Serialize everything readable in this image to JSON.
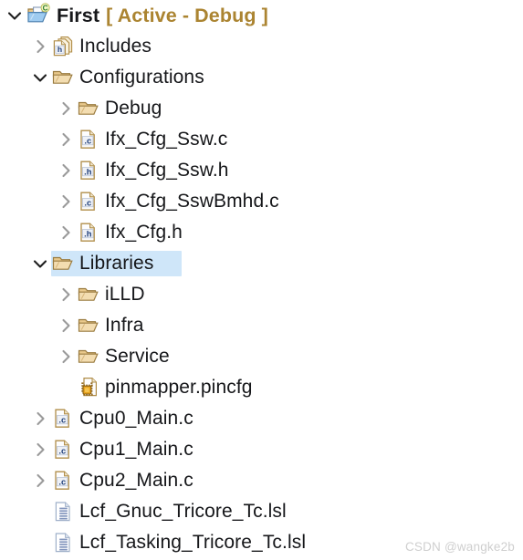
{
  "colors": {
    "background": "#ffffff",
    "text": "#16171a",
    "active_config_text": "#ab8431",
    "selection": "#cfe6f9",
    "folder_fill": "#e9c98c",
    "folder_stroke": "#9a7b3f",
    "file_stroke": "#b08d48",
    "c_badge_text": "#1f3f7a",
    "h_badge_text": "#1f3f7a",
    "lsl_line": "#8396bd",
    "chip_fill": "#e8a41f",
    "watermark": "#cfcfcf",
    "twisty_collapsed": "#9a9a9a",
    "twisty_expanded": "#1d1d1d"
  },
  "watermark": "CSDN @wangke2b",
  "tree": {
    "name": "project-explorer-tree",
    "items": [
      {
        "label": "First",
        "suffix": "[ Active - Debug ]",
        "level": 0,
        "icon": "project-folder-c-icon",
        "state": "expanded",
        "selected": false,
        "bold": true
      },
      {
        "label": "Includes",
        "level": 1,
        "icon": "includes-stack-h-icon",
        "state": "collapsed",
        "selected": false
      },
      {
        "label": "Configurations",
        "level": 1,
        "icon": "folder-icon",
        "state": "expanded",
        "selected": false
      },
      {
        "label": "Debug",
        "level": 2,
        "icon": "folder-icon",
        "state": "collapsed",
        "selected": false
      },
      {
        "label": "Ifx_Cfg_Ssw.c",
        "level": 2,
        "icon": "c-source-file-icon",
        "state": "collapsed",
        "selected": false
      },
      {
        "label": "Ifx_Cfg_Ssw.h",
        "level": 2,
        "icon": "h-header-file-icon",
        "state": "collapsed",
        "selected": false
      },
      {
        "label": "Ifx_Cfg_SswBmhd.c",
        "level": 2,
        "icon": "c-source-file-icon",
        "state": "collapsed",
        "selected": false
      },
      {
        "label": "Ifx_Cfg.h",
        "level": 2,
        "icon": "h-header-file-icon",
        "state": "collapsed",
        "selected": false
      },
      {
        "label": "Libraries",
        "level": 1,
        "icon": "folder-icon",
        "state": "expanded",
        "selected": true
      },
      {
        "label": "iLLD",
        "level": 2,
        "icon": "folder-icon",
        "state": "collapsed",
        "selected": false
      },
      {
        "label": "Infra",
        "level": 2,
        "icon": "folder-icon",
        "state": "collapsed",
        "selected": false
      },
      {
        "label": "Service",
        "level": 2,
        "icon": "folder-icon",
        "state": "collapsed",
        "selected": false
      },
      {
        "label": "pinmapper.pincfg",
        "level": 2,
        "icon": "pincfg-chip-file-icon",
        "state": "leaf",
        "selected": false
      },
      {
        "label": "Cpu0_Main.c",
        "level": 1,
        "icon": "c-source-file-icon",
        "state": "collapsed",
        "selected": false
      },
      {
        "label": "Cpu1_Main.c",
        "level": 1,
        "icon": "c-source-file-icon",
        "state": "collapsed",
        "selected": false
      },
      {
        "label": "Cpu2_Main.c",
        "level": 1,
        "icon": "c-source-file-icon",
        "state": "collapsed",
        "selected": false
      },
      {
        "label": "Lcf_Gnuc_Tricore_Tc.lsl",
        "level": 1,
        "icon": "lsl-script-file-icon",
        "state": "leaf",
        "selected": false
      },
      {
        "label": "Lcf_Tasking_Tricore_Tc.lsl",
        "level": 1,
        "icon": "lsl-script-file-icon",
        "state": "leaf",
        "selected": false
      }
    ]
  }
}
